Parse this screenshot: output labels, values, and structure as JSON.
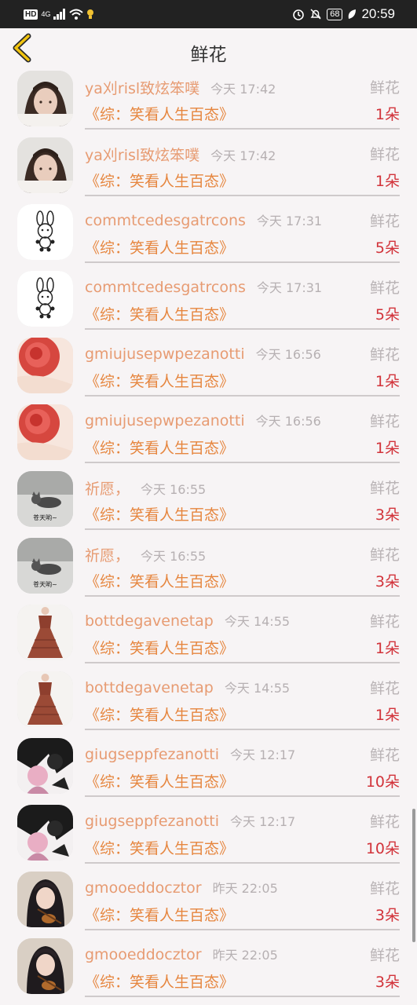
{
  "status_bar": {
    "hd": "HD",
    "signal": "4G",
    "battery": "68",
    "time": "20:59",
    "icons": [
      "wifi-icon",
      "bulb-icon",
      "alarm-icon",
      "mute-bell-icon",
      "leaf-icon"
    ]
  },
  "header": {
    "title": "鲜花",
    "back_icon": "chevron-left-icon"
  },
  "items": [
    {
      "name": "ya刈risl致炫笨噗",
      "time": "今天 17:42",
      "kind": "鲜花",
      "book": "《综：笑看人生百态》",
      "count": "1朵",
      "avatar": "girl-photo"
    },
    {
      "name": "ya刈risl致炫笨噗",
      "time": "今天 17:42",
      "kind": "鲜花",
      "book": "《综：笑看人生百态》",
      "count": "1朵",
      "avatar": "girl-photo"
    },
    {
      "name": "commtcedesgatrcons",
      "time": "今天 17:31",
      "kind": "鲜花",
      "book": "《综：笑看人生百态》",
      "count": "5朵",
      "avatar": "bunny-drawing"
    },
    {
      "name": "commtcedesgatrcons",
      "time": "今天 17:31",
      "kind": "鲜花",
      "book": "《综：笑看人生百态》",
      "count": "5朵",
      "avatar": "bunny-drawing"
    },
    {
      "name": "gmiujusepwpezanotti",
      "time": "今天 16:56",
      "kind": "鲜花",
      "book": "《综：笑看人生百态》",
      "count": "1朵",
      "avatar": "rose-photo"
    },
    {
      "name": "gmiujusepwpezanotti",
      "time": "今天 16:56",
      "kind": "鲜花",
      "book": "《综：笑看人生百态》",
      "count": "1朵",
      "avatar": "rose-photo"
    },
    {
      "name": "祈愿，",
      "time": "今天 16:55",
      "kind": "鲜花",
      "book": "《综：笑看人生百态》",
      "count": "3朵",
      "avatar": "cat-photo",
      "avatar_caption": "苍天哟~"
    },
    {
      "name": "祈愿，",
      "time": "今天 16:55",
      "kind": "鲜花",
      "book": "《综：笑看人生百态》",
      "count": "3朵",
      "avatar": "cat-photo",
      "avatar_caption": "苍天哟~"
    },
    {
      "name": "bottdegavenetap",
      "time": "今天 14:55",
      "kind": "鲜花",
      "book": "《综：笑看人生百态》",
      "count": "1朵",
      "avatar": "dress-photo"
    },
    {
      "name": "bottdegavenetap",
      "time": "今天 14:55",
      "kind": "鲜花",
      "book": "《综：笑看人生百态》",
      "count": "1朵",
      "avatar": "dress-photo"
    },
    {
      "name": "giugseppfezanotti",
      "time": "今天 12:17",
      "kind": "鲜花",
      "book": "《综：笑看人生百态》",
      "count": "10朵",
      "avatar": "anime-art"
    },
    {
      "name": "giugseppfezanotti",
      "time": "今天 12:17",
      "kind": "鲜花",
      "book": "《综：笑看人生百态》",
      "count": "10朵",
      "avatar": "anime-art"
    },
    {
      "name": "gmooeddocztor",
      "time": "昨天 22:05",
      "kind": "鲜花",
      "book": "《综：笑看人生百态》",
      "count": "3朵",
      "avatar": "girl-violin-photo"
    },
    {
      "name": "gmooeddocztor",
      "time": "昨天 22:05",
      "kind": "鲜花",
      "book": "《综：笑看人生百态》",
      "count": "3朵",
      "avatar": "girl-violin-photo"
    }
  ],
  "colors": {
    "name": "#e79b72",
    "book": "#e6863f",
    "count": "#d2333a",
    "meta": "#b6b0b2",
    "background": "#f7f4f5"
  }
}
